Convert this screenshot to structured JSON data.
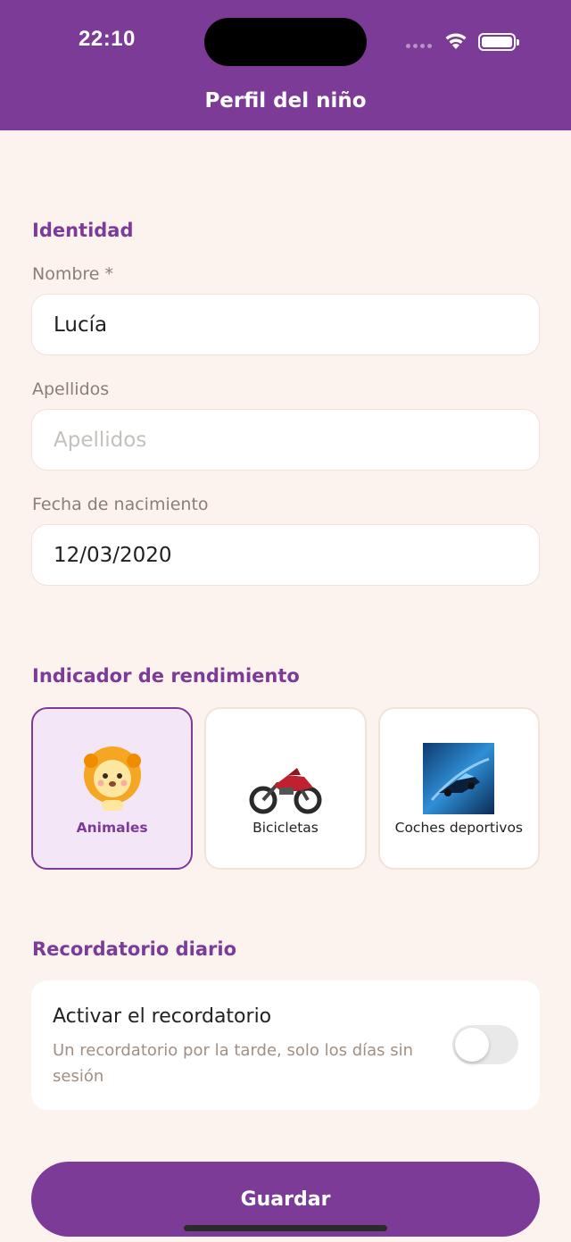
{
  "status_bar": {
    "time": "22:10"
  },
  "header": {
    "title": "Perfil del niño"
  },
  "identity": {
    "section_title": "Identidad",
    "first_name": {
      "label": "Nombre *",
      "value": "Lucía"
    },
    "last_name": {
      "label": "Apellidos",
      "placeholder": "Apellidos",
      "value": ""
    },
    "birth_date": {
      "label": "Fecha de nacimiento",
      "value": "12/03/2020"
    }
  },
  "performance": {
    "section_title": "Indicador de rendimiento",
    "options": [
      {
        "label": "Animales",
        "icon": "lion-icon",
        "selected": true
      },
      {
        "label": "Bicicletas",
        "icon": "motorcycle-icon",
        "selected": false
      },
      {
        "label": "Coches deportivos",
        "icon": "sports-car-icon",
        "selected": false
      }
    ]
  },
  "reminder": {
    "section_title": "Recordatorio diario",
    "title": "Activar el recordatorio",
    "description": "Un recordatorio por la tarde, solo los días sin sesión",
    "enabled": false
  },
  "actions": {
    "save_label": "Guardar"
  },
  "colors": {
    "primary": "#7c3b96",
    "background": "#fcf3ee",
    "selected_card": "#f3e6f7"
  }
}
